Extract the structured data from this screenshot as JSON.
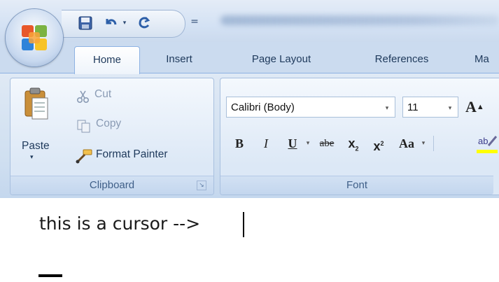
{
  "tabs": [
    "Home",
    "Insert",
    "Page Layout",
    "References",
    "Ma"
  ],
  "clipboard": {
    "paste_label": "Paste",
    "cut_label": "Cut",
    "copy_label": "Copy",
    "format_painter_label": "Format Painter",
    "group_label": "Clipboard"
  },
  "font": {
    "font_name": "Calibri (Body)",
    "font_size": "11",
    "grow_label": "A",
    "bold_label": "B",
    "italic_label": "I",
    "underline_label": "U",
    "strike_label": "abe",
    "subscript_label": "x",
    "superscript_label": "x",
    "change_case_label": "Aa",
    "highlight_label": "ab",
    "group_label": "Font"
  },
  "document": {
    "text": "this is a cursor -->"
  },
  "colors": {
    "ribbon_blue": "#cfdff0",
    "tab_text": "#1e395b",
    "highlight_yellow": "#ffff00"
  }
}
